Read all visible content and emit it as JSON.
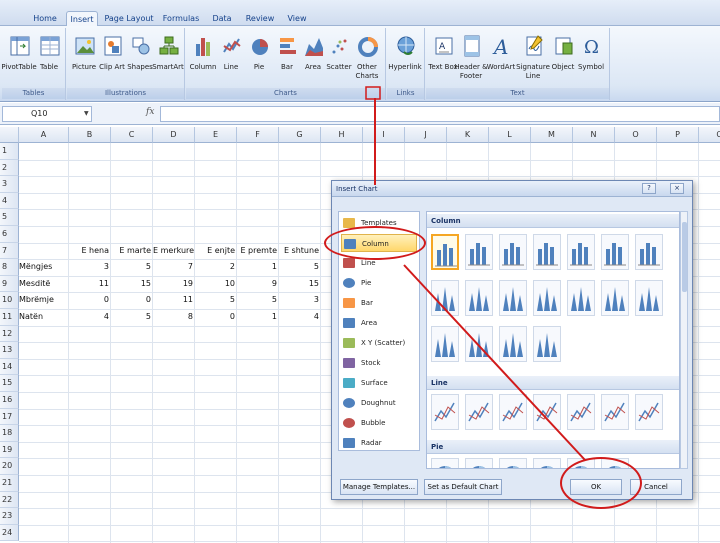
{
  "tabs": [
    {
      "label": "Home",
      "active": false
    },
    {
      "label": "Insert",
      "active": true
    },
    {
      "label": "Page Layout",
      "active": false
    },
    {
      "label": "Formulas",
      "active": false
    },
    {
      "label": "Data",
      "active": false
    },
    {
      "label": "Review",
      "active": false
    },
    {
      "label": "View",
      "active": false
    }
  ],
  "ribbon": {
    "groups": [
      {
        "label": "Tables",
        "buttons": [
          {
            "label": "PivotTable",
            "icon": "pivottable-icon"
          },
          {
            "label": "Table",
            "icon": "table-icon"
          }
        ]
      },
      {
        "label": "Illustrations",
        "buttons": [
          {
            "label": "Picture",
            "icon": "picture-icon"
          },
          {
            "label": "Clip Art",
            "icon": "clipart-icon"
          },
          {
            "label": "Shapes",
            "icon": "shapes-icon"
          },
          {
            "label": "SmartArt",
            "icon": "smartart-icon"
          }
        ]
      },
      {
        "label": "Charts",
        "buttons": [
          {
            "label": "Column",
            "icon": "column-chart-icon"
          },
          {
            "label": "Line",
            "icon": "line-chart-icon"
          },
          {
            "label": "Pie",
            "icon": "pie-chart-icon"
          },
          {
            "label": "Bar",
            "icon": "bar-chart-icon"
          },
          {
            "label": "Area",
            "icon": "area-chart-icon"
          },
          {
            "label": "Scatter",
            "icon": "scatter-chart-icon"
          },
          {
            "label": "Other Charts",
            "icon": "other-charts-icon"
          }
        ]
      },
      {
        "label": "Links",
        "buttons": [
          {
            "label": "Hyperlink",
            "icon": "hyperlink-icon"
          }
        ]
      },
      {
        "label": "Text",
        "buttons": [
          {
            "label": "Text Box",
            "icon": "textbox-icon"
          },
          {
            "label": "Header & Footer",
            "icon": "header-footer-icon"
          },
          {
            "label": "WordArt",
            "icon": "wordart-icon"
          },
          {
            "label": "Signature Line",
            "icon": "signature-icon"
          },
          {
            "label": "Object",
            "icon": "object-icon"
          },
          {
            "label": "Symbol",
            "icon": "symbol-icon"
          }
        ]
      }
    ]
  },
  "formula_bar": {
    "name_box": "Q10",
    "fx": "fx",
    "formula": ""
  },
  "grid": {
    "columns": [
      "A",
      "B",
      "C",
      "D",
      "E",
      "F",
      "G",
      "H",
      "I",
      "J",
      "K",
      "L",
      "M",
      "N",
      "O",
      "P",
      "Q"
    ],
    "rows": [
      "1",
      "2",
      "3",
      "4",
      "5",
      "6",
      "7",
      "8",
      "9",
      "10",
      "11",
      "12",
      "13",
      "14",
      "15",
      "16",
      "17",
      "18",
      "19",
      "20",
      "21",
      "22",
      "23",
      "24"
    ],
    "header_row": [
      "",
      "E hena",
      "E marte",
      "E merkure",
      "E enjte",
      "E premte",
      "E shtune"
    ],
    "data_rows": [
      [
        "Mëngjes",
        "3",
        "5",
        "7",
        "2",
        "1",
        "5"
      ],
      [
        "Mesditë",
        "11",
        "15",
        "19",
        "10",
        "9",
        "15"
      ],
      [
        "Mbrëmje",
        "0",
        "0",
        "11",
        "5",
        "5",
        "3"
      ],
      [
        "Natën",
        "4",
        "5",
        "8",
        "0",
        "1",
        "4"
      ]
    ]
  },
  "dialog": {
    "title": "Insert Chart",
    "help": "?",
    "close": "×",
    "categories": [
      {
        "label": "Templates",
        "icon": "folder-icon"
      },
      {
        "label": "Column",
        "icon": "column-chart-icon",
        "selected": true
      },
      {
        "label": "Line",
        "icon": "line-chart-icon"
      },
      {
        "label": "Pie",
        "icon": "pie-chart-icon"
      },
      {
        "label": "Bar",
        "icon": "bar-chart-icon"
      },
      {
        "label": "Area",
        "icon": "area-chart-icon"
      },
      {
        "label": "X Y (Scatter)",
        "icon": "scatter-chart-icon"
      },
      {
        "label": "Stock",
        "icon": "stock-chart-icon"
      },
      {
        "label": "Surface",
        "icon": "surface-chart-icon"
      },
      {
        "label": "Doughnut",
        "icon": "doughnut-chart-icon"
      },
      {
        "label": "Bubble",
        "icon": "bubble-chart-icon"
      },
      {
        "label": "Radar",
        "icon": "radar-chart-icon"
      }
    ],
    "sections": [
      "Column",
      "Line",
      "Pie"
    ],
    "manage_templates": "Manage Templates...",
    "set_default": "Set as Default Chart",
    "ok": "OK",
    "cancel": "Cancel"
  },
  "colors": {
    "annotation": "#d11b1b",
    "selected": "#ffd76b",
    "ribbon": "#dce7f5"
  }
}
